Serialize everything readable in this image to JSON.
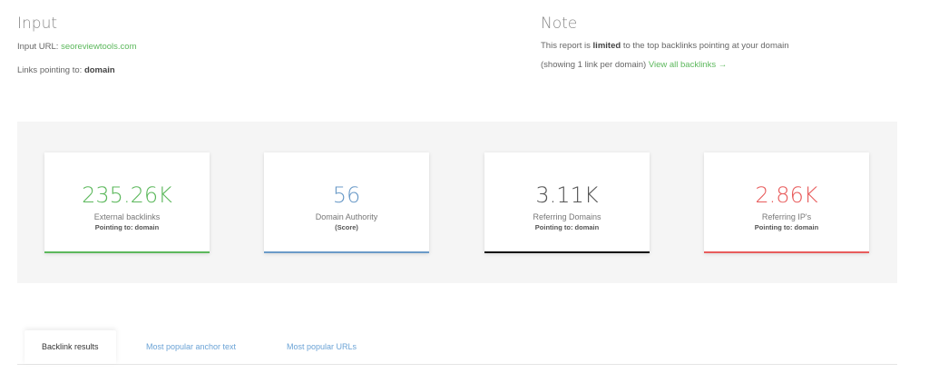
{
  "input": {
    "title": "Input",
    "url_label": "Input URL:",
    "url_value": "seoreviewtools.com",
    "links_label": "Links pointing to:",
    "links_value": "domain"
  },
  "note": {
    "title": "Note",
    "line1_prefix": "This report is",
    "line1_bold": "limited",
    "line1_suffix": "to the top backlinks pointing at your domain",
    "line2_prefix": "(showing 1 link per domain)",
    "link_text": "View all backlinks →"
  },
  "stats": [
    {
      "value": "235.26K",
      "label": "External backlinks",
      "sub": "Pointing to: domain",
      "color": "#5cb85c"
    },
    {
      "value": "56",
      "label": "Domain Authority",
      "sub": "(Score)",
      "color": "#6b9bc8"
    },
    {
      "value": "3.11K",
      "label": "Referring Domains",
      "sub": "Pointing to: domain",
      "color": "#555555",
      "bar_color": "#111111"
    },
    {
      "value": "2.86K",
      "label": "Referring IP's",
      "sub": "Pointing to: domain",
      "color": "#e85c5c"
    }
  ],
  "tabs": [
    {
      "label": "Backlink results",
      "active": true
    },
    {
      "label": "Most popular anchor text",
      "active": false
    },
    {
      "label": "Most popular URLs",
      "active": false
    }
  ]
}
